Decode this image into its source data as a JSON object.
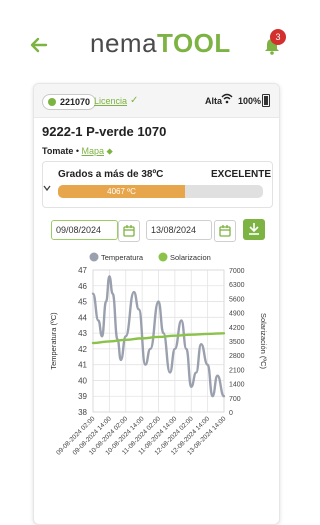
{
  "header": {
    "back_icon": "arrow-left-icon",
    "logo_part1": "nema",
    "logo_part2": "TOOL",
    "notification_count": "3",
    "accent": "#7cb342"
  },
  "device": {
    "id": "221070",
    "licencia": "Licencia",
    "signal": "Alta",
    "battery": "100%",
    "name": "9222-1 P-verde 1070",
    "crop": "Tomate",
    "separator": " • ",
    "map_link": "Mapa"
  },
  "metric": {
    "label": "Grados a más de 38ºC",
    "status": "EXCELENTE",
    "value": "4067 ºC",
    "progress": 0.62,
    "fill_color": "#e8a64c"
  },
  "filters": {
    "date_from": "09/08/2024",
    "date_to": "13/08/2024"
  },
  "chart_data": {
    "type": "line",
    "legend": [
      "Temperatura",
      "Solarizacion"
    ],
    "series": [
      {
        "name": "Temperatura",
        "color": "#9aa0ad",
        "axis": "left",
        "values": [
          [
            0,
            45.5
          ],
          [
            0.33,
            43.8
          ],
          [
            0.55,
            42.8
          ],
          [
            0.8,
            45.0
          ],
          [
            1.0,
            46.6
          ],
          [
            1.2,
            45.5
          ],
          [
            1.5,
            42.6
          ],
          [
            1.7,
            41.3
          ],
          [
            2.0,
            42.8
          ],
          [
            2.5,
            45.6
          ],
          [
            2.8,
            44.5
          ],
          [
            3.2,
            41.0
          ],
          [
            3.5,
            42.0
          ],
          [
            4.0,
            45.0
          ],
          [
            4.3,
            43.0
          ],
          [
            4.7,
            40.5
          ],
          [
            5.0,
            42.0
          ],
          [
            5.4,
            43.8
          ],
          [
            5.7,
            42.0
          ],
          [
            6.0,
            39.6
          ],
          [
            6.3,
            40.5
          ],
          [
            6.6,
            42.3
          ],
          [
            7.0,
            41.0
          ],
          [
            7.3,
            39.0
          ],
          [
            7.6,
            40.3
          ],
          [
            8.0,
            39.0
          ]
        ]
      },
      {
        "name": "Solarizacion",
        "color": "#8bc34a",
        "axis": "right",
        "values": [
          [
            0,
            3400
          ],
          [
            1,
            3480
          ],
          [
            2,
            3560
          ],
          [
            3,
            3630
          ],
          [
            4,
            3700
          ],
          [
            5,
            3760
          ],
          [
            6,
            3810
          ],
          [
            7,
            3850
          ],
          [
            8,
            3880
          ]
        ]
      }
    ],
    "x_labels": [
      "09-08-2024 02:00",
      "09-08-2024 14:00",
      "10-08-2024 02:00",
      "10-08-2024 14:00",
      "11-08-2024 02:00",
      "11-08-2024 14:00",
      "12-08-2024 02:00",
      "12-08-2024 14:00",
      "13-08-2024 14:00"
    ],
    "y_left_label": "Temperatura (ºC)",
    "y_left_ticks": [
      38,
      39,
      40,
      41,
      42,
      43,
      44,
      45,
      46,
      47
    ],
    "y_left_range": [
      38,
      47
    ],
    "y_right_label": "Solarización (ºC)",
    "y_right_ticks": [
      0,
      700,
      1400,
      2100,
      2800,
      3500,
      4200,
      4900,
      5600,
      6300,
      7000
    ],
    "y_right_range": [
      0,
      7000
    ],
    "grid": true
  }
}
